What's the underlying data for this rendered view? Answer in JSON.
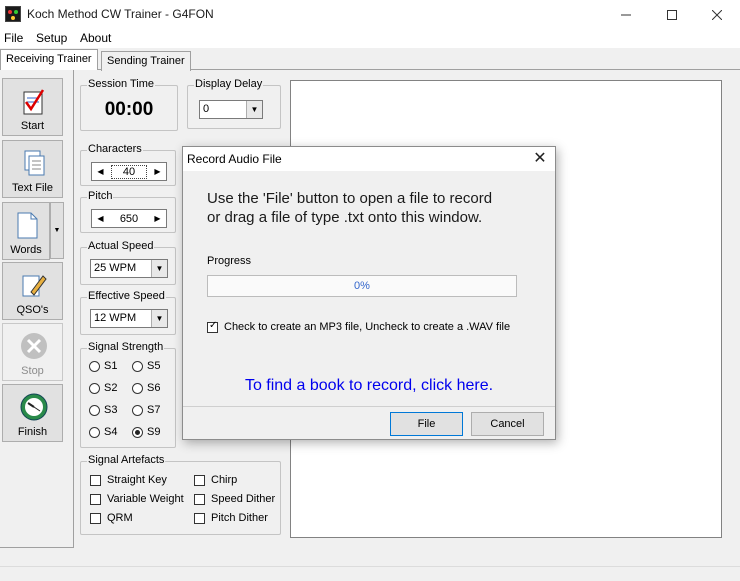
{
  "window": {
    "title": "Koch Method CW Trainer - G4FON"
  },
  "menu": [
    "File",
    "Setup",
    "About"
  ],
  "tabs": [
    "Receiving Trainer",
    "Sending Trainer"
  ],
  "toolbar": {
    "start": "Start",
    "text_file": "Text File",
    "words": "Words",
    "qsos": "QSO's",
    "stop": "Stop",
    "finish": "Finish"
  },
  "session": {
    "title": "Session Time",
    "value": "00:00"
  },
  "display_delay": {
    "title": "Display Delay",
    "value": "0"
  },
  "characters": {
    "title": "Characters",
    "value": "40"
  },
  "pitch": {
    "title": "Pitch",
    "value": "650"
  },
  "actual_speed": {
    "title": "Actual Speed",
    "value": "25 WPM"
  },
  "effective_speed": {
    "title": "Effective Speed",
    "value": "12 WPM"
  },
  "signal_strength": {
    "title": "Signal Strength",
    "options": [
      "S1",
      "S2",
      "S3",
      "S4",
      "S5",
      "S6",
      "S7",
      "S9"
    ],
    "selected": "S9"
  },
  "artefacts": {
    "title": "Signal Artefacts",
    "items": [
      "Straight Key",
      "Variable Weight",
      "QRM",
      "Chirp",
      "Speed Dither",
      "Pitch Dither"
    ]
  },
  "dialog": {
    "title": "Record Audio File",
    "instruction_line1": "Use the 'File' button to open a file to record",
    "instruction_line2": "or drag a file of type .txt onto this window.",
    "progress_label": "Progress",
    "progress_value": 0,
    "progress_text": "0%",
    "mp3_label": "Check to create an MP3 file, Uncheck to create a .WAV file",
    "mp3_checked": true,
    "link_text": "To find a book to record, click here.",
    "file_button": "File",
    "cancel_button": "Cancel"
  }
}
